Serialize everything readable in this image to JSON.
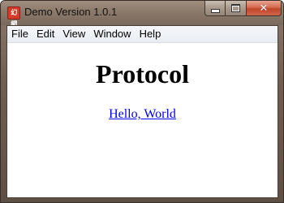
{
  "window": {
    "title": "Demo Version 1.0.1",
    "app_icon_text": "幻網",
    "caption": {
      "minimize": "minimize-icon",
      "maximize": "maximize-icon",
      "close": "close-icon",
      "close_glyph": "✕"
    }
  },
  "menubar": {
    "items": [
      {
        "label": "File"
      },
      {
        "label": "Edit"
      },
      {
        "label": "View"
      },
      {
        "label": "Window"
      },
      {
        "label": "Help"
      }
    ]
  },
  "page": {
    "heading": "Protocol",
    "link_text": "Hello, World"
  },
  "colors": {
    "link": "#0000ee",
    "close_button": "#c9462b",
    "app_icon": "#d63a2a"
  }
}
